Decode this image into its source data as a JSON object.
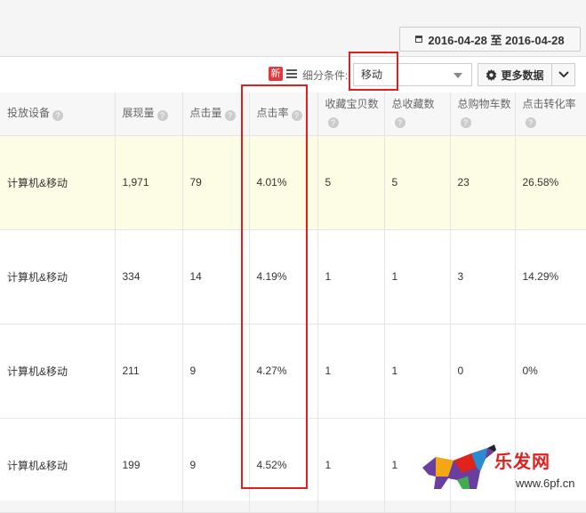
{
  "date_range": "2016-04-28 至 2016-04-28",
  "toolbar": {
    "new_badge": "新",
    "filter_label": "细分条件:",
    "filter_value": "移动",
    "more_data": "更多数据"
  },
  "table": {
    "headers": [
      "投放设备",
      "展现量",
      "点击量",
      "点击率",
      "收藏宝贝数",
      "总收藏数",
      "总购物车数",
      "点击转化率"
    ],
    "rows": [
      [
        "计算机&移动",
        "1,971",
        "79",
        "4.01%",
        "5",
        "5",
        "23",
        "26.58%"
      ],
      [
        "计算机&移动",
        "334",
        "14",
        "4.19%",
        "1",
        "1",
        "3",
        "14.29%"
      ],
      [
        "计算机&移动",
        "211",
        "9",
        "4.27%",
        "1",
        "1",
        "0",
        "0%"
      ],
      [
        "计算机&移动",
        "199",
        "9",
        "4.52%",
        "1",
        "1",
        "",
        ""
      ]
    ]
  },
  "watermark": {
    "text": "乐发网",
    "url": "www.6pf.cn"
  },
  "colors": {
    "highlight": "#e0201f",
    "row_highlight": "#fdfde6",
    "badge": "#e4393c"
  },
  "icons": [
    "calendar-icon",
    "list-icon",
    "caret-down-icon",
    "gear-icon",
    "chevron-down-icon",
    "help-icon"
  ]
}
